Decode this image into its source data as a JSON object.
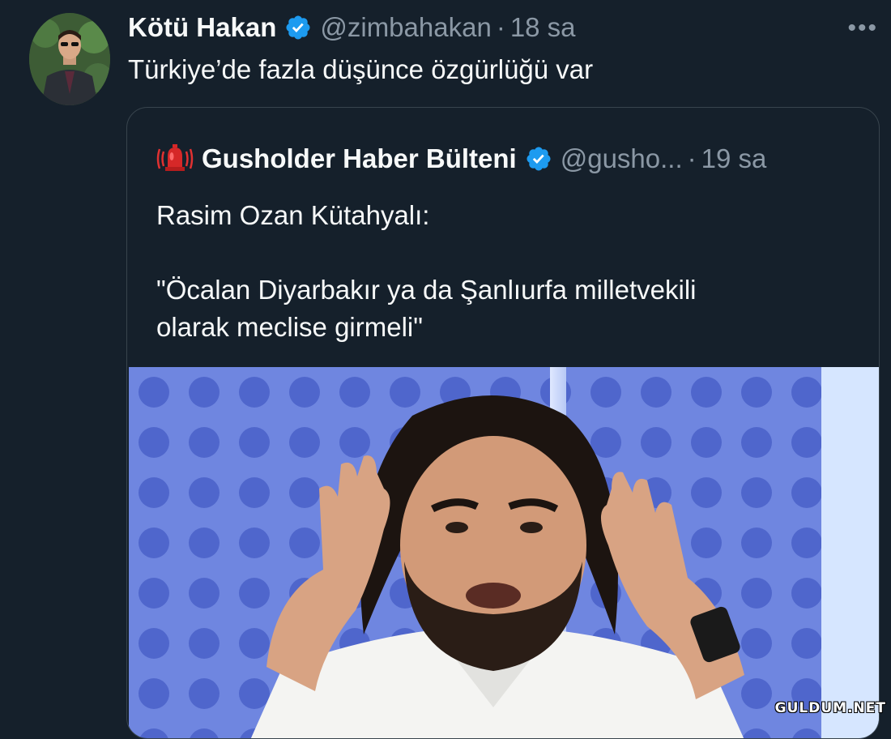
{
  "tweet": {
    "author": {
      "display_name": "Kötü Hakan",
      "handle": "@zimbahakan",
      "separator": "·",
      "timestamp": "18 sa",
      "verified": true
    },
    "text": "Türkiye’de fazla düşünce özgürlüğü var",
    "more_label": "•••"
  },
  "quoted_tweet": {
    "author": {
      "display_name": "Gusholder Haber Bülteni",
      "handle": "@gusho...",
      "separator": "·",
      "timestamp": "19 sa",
      "verified": true,
      "avatar_icon": "alarm-bell-icon"
    },
    "text_line_1": "Rasim Ozan Kütahyalı:",
    "text_line_2": "\"Öcalan Diyarbakır ya da Şanlıurfa milletvekili",
    "text_line_3": "olarak meclise girmeli\""
  },
  "watermark": "GULDUM.NET",
  "colors": {
    "background": "#15202b",
    "text": "#f7f9f9",
    "secondary_text": "#8b98a5",
    "verified": "#1d9bf0",
    "border": "#38444d"
  }
}
